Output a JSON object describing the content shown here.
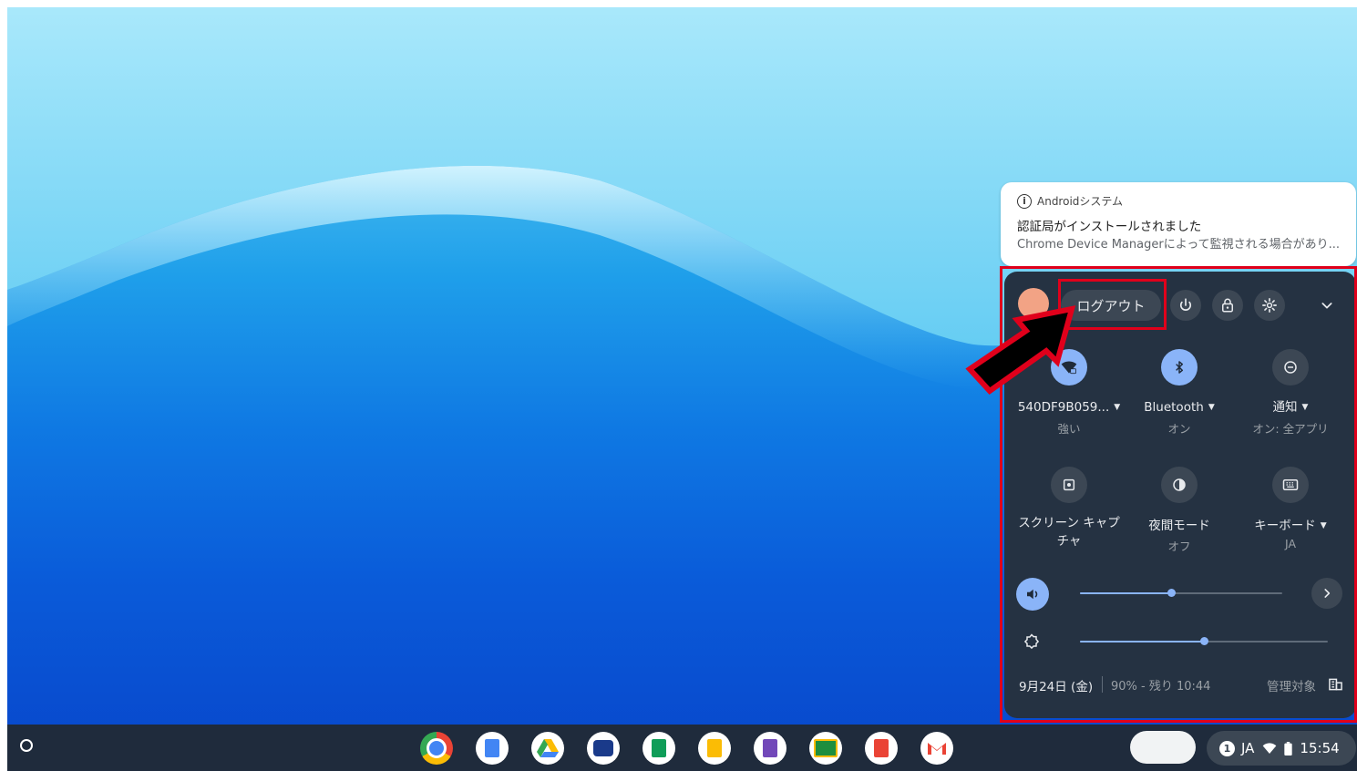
{
  "notification": {
    "app_name": "Androidシステム",
    "title": "認証局がインストールされました",
    "message": "Chrome Device Managerによって監視される場合があり..."
  },
  "quick_settings": {
    "logout_label": "ログアウト",
    "tiles": [
      {
        "label": "540DF9B059...",
        "sub": "強い",
        "icon": "wifi-lock-icon",
        "state": "on",
        "has_menu": true
      },
      {
        "label": "Bluetooth",
        "sub": "オン",
        "icon": "bluetooth-icon",
        "state": "on",
        "has_menu": true
      },
      {
        "label": "通知",
        "sub": "オン: 全アプリ",
        "icon": "do-not-disturb-icon",
        "state": "off",
        "has_menu": true
      },
      {
        "label": "スクリーン キャプチャ",
        "sub": "",
        "icon": "screen-capture-icon",
        "state": "off",
        "has_menu": false
      },
      {
        "label": "夜間モード",
        "sub": "オフ",
        "icon": "night-light-icon",
        "state": "off",
        "has_menu": false
      },
      {
        "label": "キーボード",
        "sub": "JA",
        "icon": "keyboard-icon",
        "state": "off",
        "has_menu": true
      }
    ],
    "volume_level": 0.45,
    "brightness_level": 0.5,
    "date": "9月24日 (金)",
    "battery": "90% - 残り 10:44",
    "managed_label": "管理対象"
  },
  "tray": {
    "notification_count": "1",
    "ime": "JA",
    "time": "15:54"
  },
  "shelf_apps": [
    "Chrome",
    "Docs",
    "Drive",
    "Epson",
    "Sheets",
    "Keep",
    "Forms",
    "Classroom",
    "Slides",
    "Gmail"
  ],
  "colors": {
    "panel_bg": "#253242",
    "accent": "#8ab4f8",
    "highlight_red": "#e0001b"
  }
}
